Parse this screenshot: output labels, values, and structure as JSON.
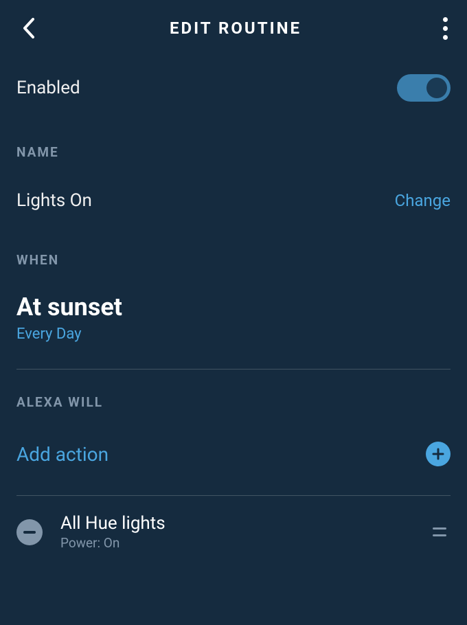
{
  "header": {
    "title": "EDIT ROUTINE"
  },
  "enabled": {
    "label": "Enabled",
    "value": true
  },
  "sections": {
    "name": {
      "header": "NAME",
      "value": "Lights On",
      "change_label": "Change"
    },
    "when": {
      "header": "WHEN",
      "title": "At sunset",
      "subtitle": "Every Day"
    },
    "alexa_will": {
      "header": "ALEXA WILL",
      "add_action_label": "Add action"
    }
  },
  "actions": [
    {
      "title": "All Hue lights",
      "subtitle": "Power: On"
    }
  ],
  "colors": {
    "background": "#152b3f",
    "accent": "#4aa6e0",
    "muted": "#8296aa",
    "toggle_track": "#3a7eac"
  }
}
